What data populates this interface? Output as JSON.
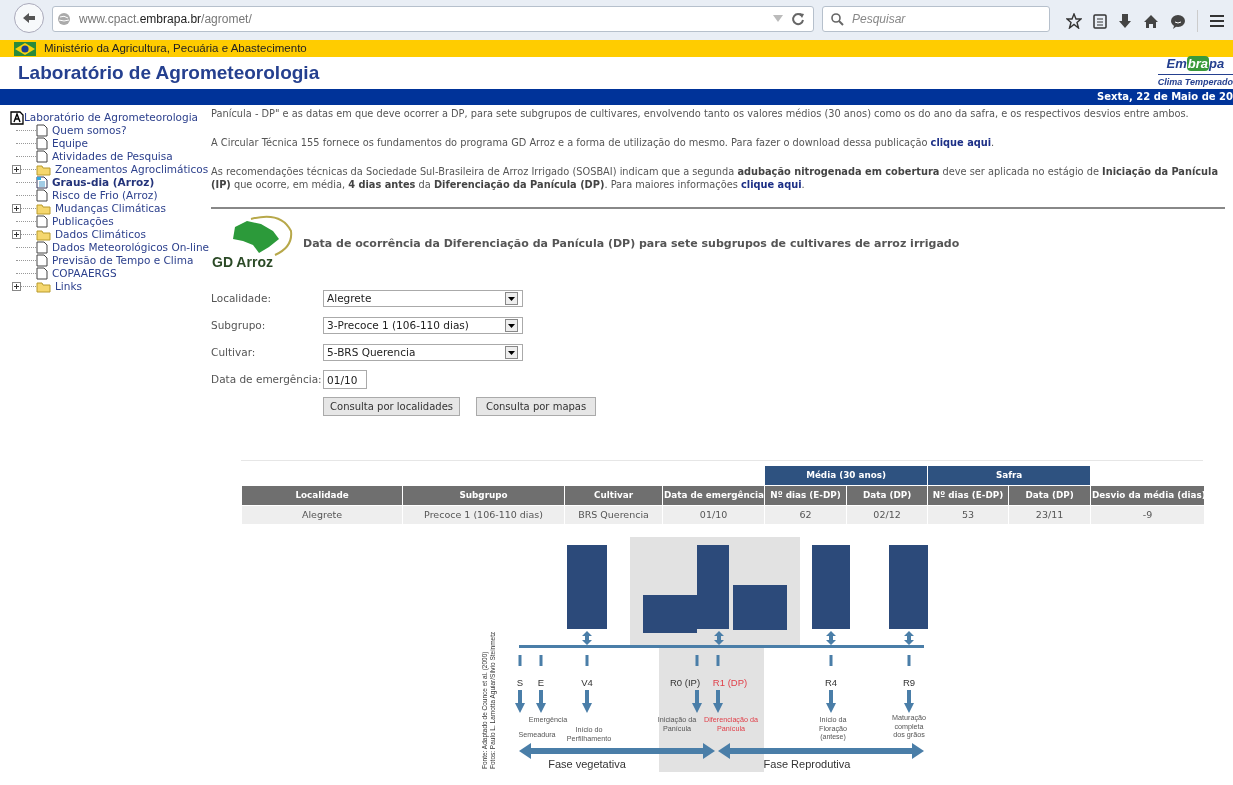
{
  "browser": {
    "url": "www.cpact.**embrapa.br**/agromet/",
    "search": {
      "placeholder": "Pesquisar"
    }
  },
  "ministry_bar": {
    "text": "Ministério da Agricultura, Pecuária e Abastecimento"
  },
  "header": {
    "title": "Laboratório de Agrometeorologia",
    "logo": {
      "parts": [
        "Em",
        "bra",
        "pa"
      ],
      "subtitle": "Clima Temperado"
    }
  },
  "date_bar": {
    "text": "Sexta, 22 de Maio de 20"
  },
  "sidebar": {
    "root": {
      "label": "Laboratório de Agrometeorologia",
      "children": [
        {
          "label": "Quem somos?",
          "kind": "page",
          "selected": false
        },
        {
          "label": "Equipe",
          "kind": "page",
          "selected": false
        },
        {
          "label": "Atividades de Pesquisa",
          "kind": "page",
          "selected": false
        },
        {
          "label": "Zoneamentos Agroclimáticos",
          "kind": "folder",
          "expanded": false,
          "selected": false
        },
        {
          "label": "Graus-dia (Arroz)",
          "kind": "page",
          "selected": true
        },
        {
          "label": "Risco de Frio (Arroz)",
          "kind": "page",
          "selected": false
        },
        {
          "label": "Mudanças Climáticas",
          "kind": "folder",
          "expanded": false,
          "selected": false
        },
        {
          "label": "Publicações",
          "kind": "page",
          "selected": false
        },
        {
          "label": "Dados Climáticos",
          "kind": "folder",
          "expanded": false,
          "selected": false
        },
        {
          "label": "Dados Meteorológicos On-line",
          "kind": "page",
          "selected": false
        },
        {
          "label": "Previsão de Tempo e Clima",
          "kind": "page",
          "selected": false
        },
        {
          "label": "COPAAERGS",
          "kind": "page",
          "selected": false
        },
        {
          "label": "Links",
          "kind": "folder",
          "expanded": false,
          "selected": false
        }
      ]
    }
  },
  "paragraphs": [
    [
      {
        "kind": "text",
        "text": "Panícula - DP\" e as datas em que deve ocorrer a DP, para sete subgrupos de cultivares, envolvendo tanto os valores médios (30 anos) como os do ano da safra, e os respectivos desvios entre ambos."
      }
    ],
    [
      {
        "kind": "text",
        "text": "A Circular Técnica 155 fornece os fundamentos do programa GD Arroz e a forma de utilização do mesmo. Para fazer o download dessa publicação "
      },
      {
        "kind": "link",
        "text": "clique aqui"
      },
      {
        "kind": "text",
        "text": "."
      }
    ],
    [
      {
        "kind": "text",
        "text": "As recomendações técnicas da Sociedade Sul-Brasileira de Arroz Irrigado (SOSBAI) indicam que a segunda **adubação nitrogenada em cobertura** deve ser aplicada no estágio de **Iniciação da Panícula (IP)** que ocorre, em média, **4 dias antes** da **Diferenciação da Panícula (DP)**. Para maiores informações "
      },
      {
        "kind": "link",
        "text": "clique aqui"
      },
      {
        "kind": "text",
        "text": "."
      }
    ]
  ],
  "tool": {
    "logo_text": "GD Arroz",
    "title": "Data de ocorrência da Diferenciação da Panícula (DP) para sete subgrupos de cultivares de arroz irrigado",
    "fields": [
      {
        "label": "Localidade:",
        "kind": "select",
        "value": "Alegrete"
      },
      {
        "label": "Subgrupo:",
        "kind": "select",
        "value": "3-Precoce 1 (106-110 dias)"
      },
      {
        "label": "Cultivar:",
        "kind": "select",
        "value": "5-BRS Querencia"
      },
      {
        "label": "Data de emergência:",
        "kind": "input",
        "value": "01/10"
      }
    ],
    "buttons": [
      "Consulta por localidades",
      "Consulta por mapas"
    ]
  },
  "table": {
    "groups": [
      {
        "label": "Média (30 anos)"
      },
      {
        "label": "Safra"
      }
    ],
    "columns": [
      "Localidade",
      "Subgrupo",
      "Cultivar",
      "Data de emergência",
      "Nº dias (E-DP)",
      "Data (DP)",
      "Nº dias (E-DP)",
      "Data (DP)",
      "Desvio da média (dias)"
    ],
    "rows": [
      [
        "Alegrete",
        "Precoce 1 (106-110 dias)",
        "BRS Querencia",
        "01/10",
        "62",
        "02/12",
        "53",
        "23/11",
        "-9"
      ]
    ]
  },
  "stage_diagram": {
    "stages": [
      {
        "code": "S",
        "label": "Semeadura",
        "highlight": false
      },
      {
        "code": "E",
        "label": "Emergência",
        "highlight": false
      },
      {
        "code": "V4",
        "label": "Início do\nPerfilhamento",
        "highlight": false
      },
      {
        "code": "R0 (IP)",
        "label": "Iniciação da\nPanícula",
        "highlight": false
      },
      {
        "code": "R1 (DP)",
        "label": "Diferenciação da\nPanícula",
        "highlight": true
      },
      {
        "code": "R4",
        "label": "Início da\nFloração",
        "note": "(antese)",
        "highlight": false
      },
      {
        "code": "R9",
        "label": "Maturação\ncompleta\ndos grãos",
        "highlight": false
      }
    ],
    "phases": [
      "Fase vegetativa",
      "Fase Reprodutiva"
    ],
    "source": [
      "Fonte: Adaptado de Counce et al. (2000)",
      "Fotos: Paulo L. Lamotta Aguiar/Silvio Steinmetz"
    ]
  }
}
